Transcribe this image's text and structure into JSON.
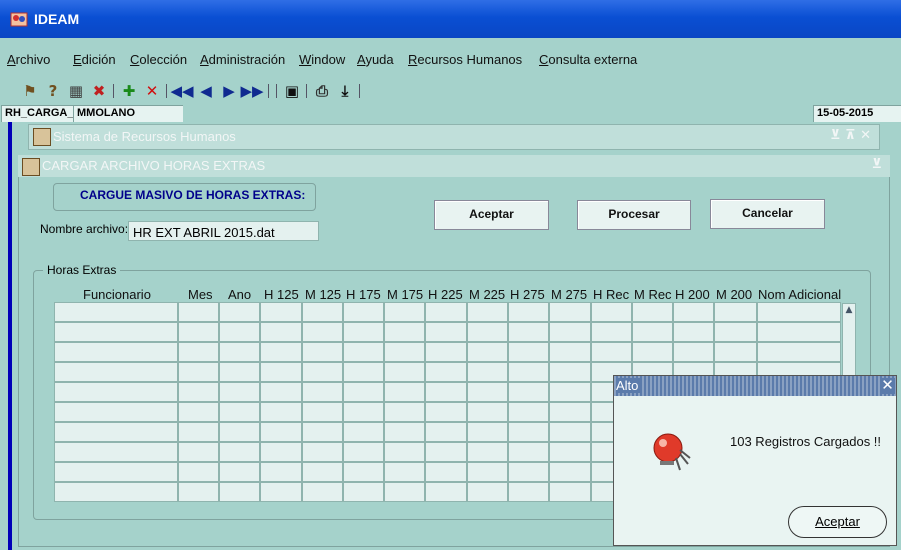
{
  "window": {
    "title": "IDEAM"
  },
  "menu": [
    {
      "label": "Archivo"
    },
    {
      "label": "Edición"
    },
    {
      "label": "Colección"
    },
    {
      "label": "Administración"
    },
    {
      "label": "Window"
    },
    {
      "label": "Ayuda"
    },
    {
      "label": "Recursos Humanos"
    },
    {
      "label": "Consulta externa"
    }
  ],
  "status": {
    "form": "RH_CARGA_H",
    "user": "MMOLANO",
    "date": "15-05-2015"
  },
  "sys_window": {
    "title": "Sistema de Recursos Humanos"
  },
  "cargar": {
    "title": "CARGAR ARCHIVO HORAS EXTRAS",
    "heading": "CARGUE MASIVO DE HORAS EXTRAS:",
    "file_label": "Nombre archivo:",
    "file_value": "HR EXT ABRIL 2015.dat",
    "buttons": {
      "aceptar": "Aceptar",
      "procesar": "Procesar",
      "cancelar": "Cancelar"
    },
    "group_label": "Horas Extras",
    "columns": [
      "Funcionario",
      "Mes",
      "Ano",
      "H 125",
      "M 125",
      "H 175",
      "M 175",
      "H 225",
      "M 225",
      "H 275",
      "M 275",
      "H Rec",
      "M Rec",
      "H 200",
      "M 200",
      "Nom Adicional"
    ]
  },
  "alert": {
    "title": "Alto",
    "message": "103 Registros Cargados !!",
    "button": "Aceptar"
  },
  "colors": {
    "titlebar": "#0a4fd3",
    "surface": "#a5d2cb",
    "heading_text": "#00008b"
  }
}
